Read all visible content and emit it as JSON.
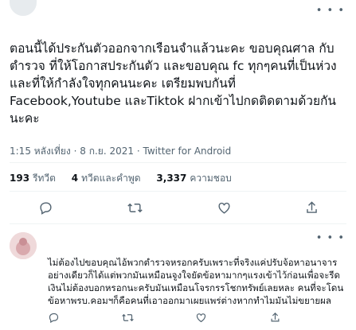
{
  "tweet": {
    "text": "ตอนนี้ได้ประกันตัวออกจากเรือนจำแล้วนะคะ ขอบคุณศาล กับตำรวจ ที่ให้โอกาสประกันตัว และขอบคุณ fc ทุกๆคนที่เป็นห่วงและที่ให้กำลังใจทุกคนนะคะ เตรียมพบกันที่ Facebook,Youtube และTiktok ฝากเข้าไปกดติดตามด้วยกันนะคะ",
    "time": "1:15 หลังเที่ยง",
    "date": "8 ก.ย. 2021",
    "source": "Twitter for Android",
    "meta_sep": "·"
  },
  "stats": {
    "retweets_count": "193",
    "retweets_label": "รีทวีต",
    "quotes_count": "4",
    "quotes_label": "ทวีตและคำพูด",
    "likes_count": "3,337",
    "likes_label": "ความชอบ"
  },
  "reply": {
    "text": "ไม่ต้องไปขอบคุณไอ้พวกตำรวจหรอกครับเพราะที่จริงแค่ปรับจ้อหาอนาจารอย่างเดียวก็ได้แต่พวกมันเหมือนจูงใจยัดข้อหามากๆแรงเข้าไว้ก่อนเพื่อจะรีดเงินไม่ต้องบอกหรอกนะครับมันเหมือนโจรกรรโชกทรัพย์เลยหละ คนที่จะโดนข้อหาพรบ.คอมฯก็คือคนที่เอาออกมาเผยแพร่ต่างหากทำไมมันไม่ขยายผล",
    "replies": "",
    "retweets": "",
    "likes": ""
  },
  "icons": {
    "more": "more-icon",
    "reply": "reply-icon",
    "retweet": "retweet-icon",
    "like": "heart-icon",
    "share": "share-icon"
  }
}
